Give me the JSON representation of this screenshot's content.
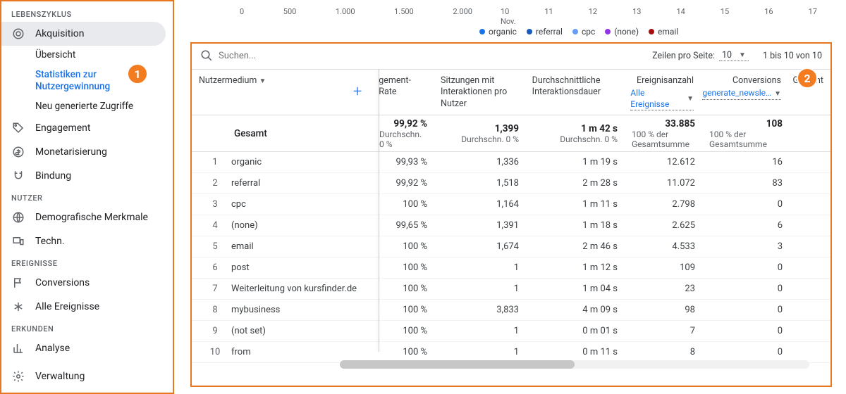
{
  "sidebar": {
    "sections": {
      "lifecycle": "LEBENSZYKLUS",
      "user": "NUTZER",
      "events": "EREIGNISSE",
      "explore": "ERKUNDEN"
    },
    "acquisition": {
      "label": "Akquisition",
      "subs": {
        "overview": "Übersicht",
        "stats": "Statistiken zur Nutzergewinnung",
        "newaccess": "Neu generierte Zugriffe"
      }
    },
    "engagement": "Engagement",
    "monetization": "Monetarisierung",
    "retention": "Bindung",
    "demographics": "Demografische Merkmale",
    "tech": "Techn.",
    "conversions": "Conversions",
    "allevents": "Alle Ereignisse",
    "analysis": "Analyse",
    "admin": "Verwaltung"
  },
  "chart": {
    "ticks": [
      "0",
      "500",
      "1.000",
      "1.500",
      "2.000"
    ],
    "days": [
      "10",
      "11",
      "12",
      "13",
      "14",
      "15",
      "16",
      "17"
    ],
    "month": "Nov.",
    "legend": {
      "organic": {
        "label": "organic",
        "color": "#1a73e8"
      },
      "referral": {
        "label": "referral",
        "color": "#185abc"
      },
      "cpc": {
        "label": "cpc",
        "color": "#669df6"
      },
      "none": {
        "label": "(none)",
        "color": "#9334e6"
      },
      "email": {
        "label": "email",
        "color": "#a50e0e"
      }
    }
  },
  "toolbar": {
    "search_placeholder": "Suchen...",
    "rpp_label": "Zeilen pro Seite:",
    "rpp_value": "10",
    "page_info": "1 bis 10 von 10"
  },
  "columns": {
    "medium": "Nutzermedium",
    "gement": "gement-Rate",
    "sessions": "Sitzungen mit Interaktionen pro Nutzer",
    "avgdur": "Durchschnittliche Interaktionsdauer",
    "events": "Ereignisanzahl",
    "events_sub": "Alle Ereignisse",
    "conv": "Conversions",
    "conv_sub": "generate_newsle…",
    "total": "Gesamt"
  },
  "totals": {
    "label": "Gesamt",
    "rate": {
      "v": "99,92 %",
      "s": "Durchschn. 0 %"
    },
    "sess": {
      "v": "1,399",
      "s": "Durchschn. 0 %"
    },
    "dur": {
      "v": "1 m 42 s",
      "s": "Durchschn. 0 %"
    },
    "evt": {
      "v": "33.885",
      "s": "100 % der Gesamtsumme"
    },
    "conv": {
      "v": "108",
      "s": "100 % der Gesamtsumme"
    }
  },
  "rows": [
    {
      "n": "1",
      "name": "organic",
      "rate": "99,93 %",
      "sess": "1,336",
      "dur": "1 m 19 s",
      "evt": "12.612",
      "conv": "16"
    },
    {
      "n": "2",
      "name": "referral",
      "rate": "99,92 %",
      "sess": "1,518",
      "dur": "2 m 28 s",
      "evt": "11.072",
      "conv": "83"
    },
    {
      "n": "3",
      "name": "cpc",
      "rate": "100 %",
      "sess": "1,164",
      "dur": "1 m 11 s",
      "evt": "2.798",
      "conv": "0"
    },
    {
      "n": "4",
      "name": "(none)",
      "rate": "99,65 %",
      "sess": "1,391",
      "dur": "1 m 18 s",
      "evt": "2.625",
      "conv": "6"
    },
    {
      "n": "5",
      "name": "email",
      "rate": "100 %",
      "sess": "1,674",
      "dur": "2 m 46 s",
      "evt": "4.533",
      "conv": "3"
    },
    {
      "n": "6",
      "name": "post",
      "rate": "100 %",
      "sess": "1",
      "dur": "1 m 12 s",
      "evt": "109",
      "conv": "0"
    },
    {
      "n": "7",
      "name": "Weiterleitung von kursfinder.de",
      "rate": "100 %",
      "sess": "1",
      "dur": "1 m 04 s",
      "evt": "23",
      "conv": "0"
    },
    {
      "n": "8",
      "name": "mybusiness",
      "rate": "100 %",
      "sess": "3,833",
      "dur": "4 m 09 s",
      "evt": "98",
      "conv": "0"
    },
    {
      "n": "9",
      "name": "(not set)",
      "rate": "100 %",
      "sess": "1",
      "dur": "0 m 01 s",
      "evt": "7",
      "conv": "0"
    },
    {
      "n": "10",
      "name": "from",
      "rate": "100 %",
      "sess": "1",
      "dur": "0 m 11 s",
      "evt": "8",
      "conv": "0"
    }
  ],
  "badges": {
    "b1": "1",
    "b2": "2"
  }
}
